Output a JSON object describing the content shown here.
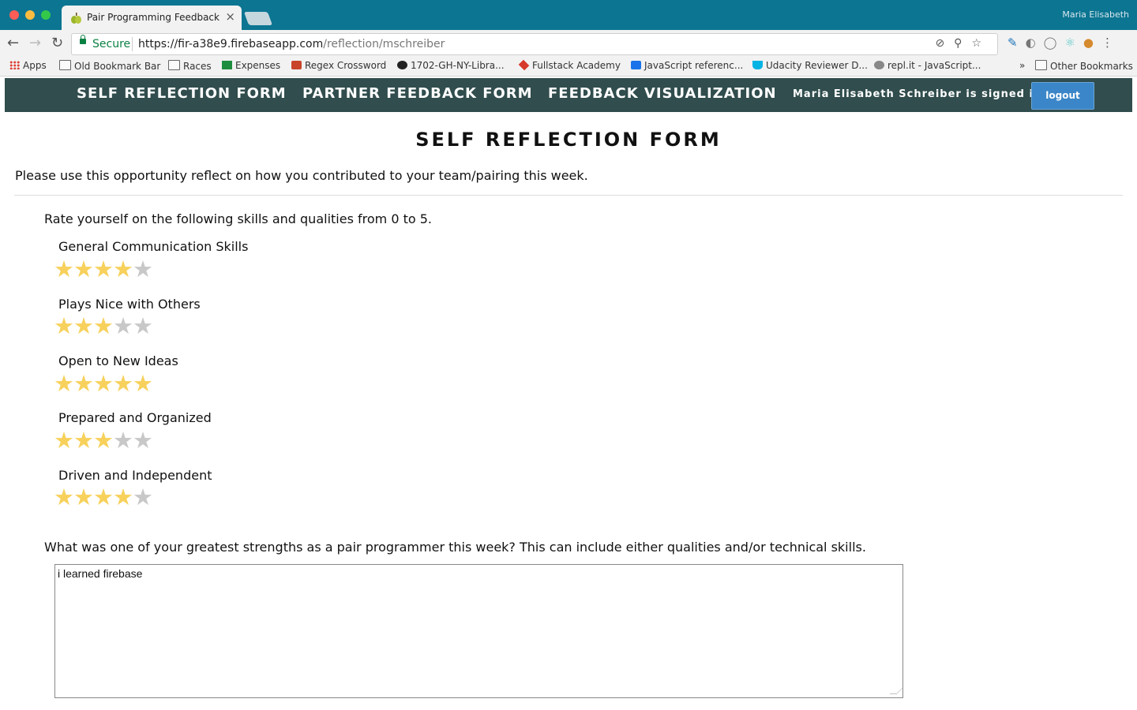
{
  "browser": {
    "tab_title": "Pair Programming Feedback",
    "tab_close": "×",
    "profile_name": "Maria Elisabeth",
    "secure_label": "Secure",
    "url_host": "https://fir-a38e9.firebaseapp.com",
    "url_path": "/reflection/mschreiber",
    "bookmarks": [
      "Apps",
      "Old Bookmark Bar",
      "Races",
      "Expenses",
      "Regex Crossword",
      "1702-GH-NY-Libra...",
      "Fullstack Academy",
      "JavaScript referenc...",
      "Udacity Reviewer D...",
      "repl.it - JavaScript...",
      "»",
      "Other Bookmarks"
    ]
  },
  "nav": {
    "links": [
      "SELF REFLECTION FORM",
      "PARTNER FEEDBACK FORM",
      "FEEDBACK VISUALIZATION"
    ],
    "signed_in_text": "Maria Elisabeth Schreiber is signed in.",
    "logout_label": "logout"
  },
  "page": {
    "title": "SELF REFLECTION FORM",
    "intro": "Please use this opportunity reflect on how you contributed to your team/pairing this week.",
    "rating_prompt": "Rate yourself on the following skills and qualities from 0 to 5.",
    "skills": [
      {
        "label": "General Communication Skills",
        "rating": 4,
        "max": 5
      },
      {
        "label": "Plays Nice with Others",
        "rating": 3,
        "max": 5
      },
      {
        "label": "Open to New Ideas",
        "rating": 5,
        "max": 5
      },
      {
        "label": "Prepared and Organized",
        "rating": 3,
        "max": 5
      },
      {
        "label": "Driven and Independent",
        "rating": 4,
        "max": 5
      }
    ],
    "question": "What was one of your greatest strengths as a pair programmer this week? This can include either qualities and/or technical skills.",
    "answer": "i learned firebase"
  },
  "colors": {
    "chrome_titlebar": "#0b7592",
    "navbar": "#314d4d",
    "logout_button": "#3a86c8",
    "star_filled": "#f7d15c",
    "star_empty": "#c8c8c8"
  }
}
